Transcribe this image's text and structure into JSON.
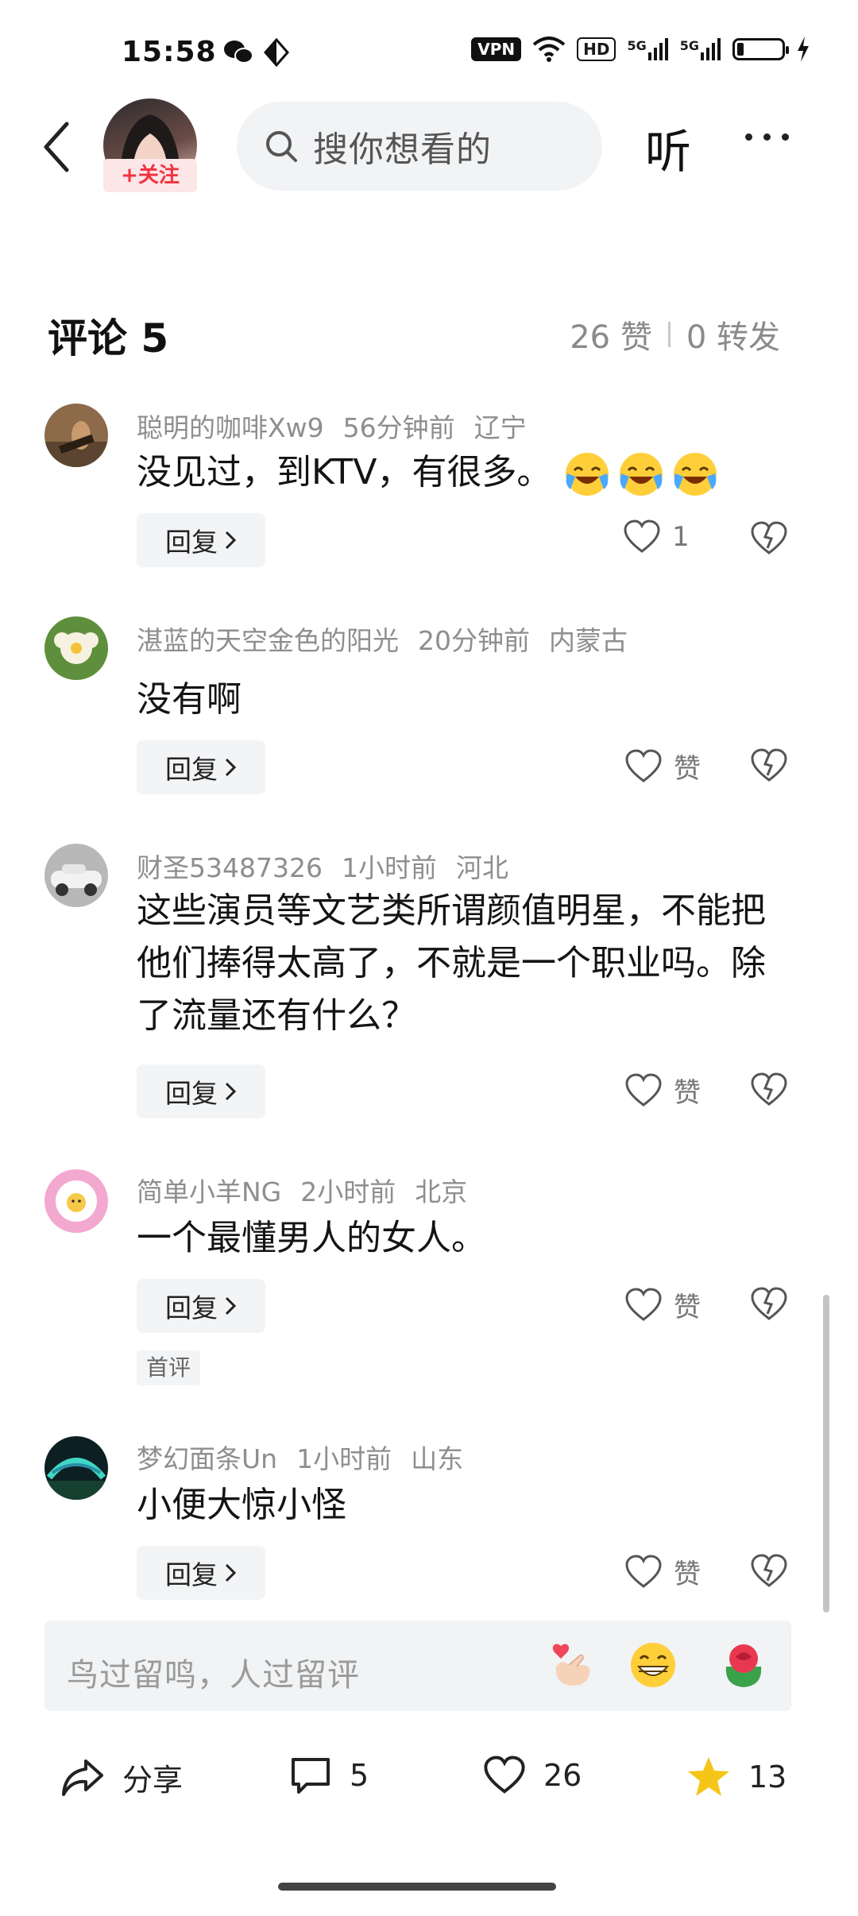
{
  "status_bar": {
    "time": "15:58",
    "vpn": "VPN",
    "hd": "HD",
    "sig1": "5G",
    "sig2": "5G"
  },
  "header": {
    "follow_label": "+关注",
    "search_placeholder": "搜你想看的",
    "listen_label": "听"
  },
  "comments_header": {
    "title": "评论 5",
    "likes": "26 赞",
    "reposts": "0 转发"
  },
  "comments": [
    {
      "user": "聪明的咖啡Xw9",
      "time": "56分钟前",
      "location": "辽宁",
      "text": "没见过，到KTV，有很多。",
      "reply": "回复",
      "likes": "1"
    },
    {
      "user": "湛蓝的天空金色的阳光",
      "time": "20分钟前",
      "location": "内蒙古",
      "text": "没有啊",
      "reply": "回复",
      "likes": "赞"
    },
    {
      "user": "财圣53487326",
      "time": "1小时前",
      "location": "河北",
      "text": "这些演员等文艺类所谓颜值明星，不能把他们捧得太高了，不就是一个职业吗。除了流量还有什么？",
      "reply": "回复",
      "likes": "赞"
    },
    {
      "user": "简单小羊NG",
      "time": "2小时前",
      "location": "北京",
      "text": "一个最懂男人的女人。",
      "reply": "回复",
      "likes": "赞",
      "badge": "首评"
    },
    {
      "user": "梦幻面条Un",
      "time": "1小时前",
      "location": "山东",
      "text": "小便大惊小怪",
      "reply": "回复",
      "likes": "赞"
    }
  ],
  "input": {
    "placeholder": "鸟过留鸣，人过留评"
  },
  "bottom_bar": {
    "share": "分享",
    "comments": "5",
    "likes": "26",
    "favorites": "13"
  },
  "colors": {
    "follow": "#f1323e",
    "star": "#f5c518"
  }
}
